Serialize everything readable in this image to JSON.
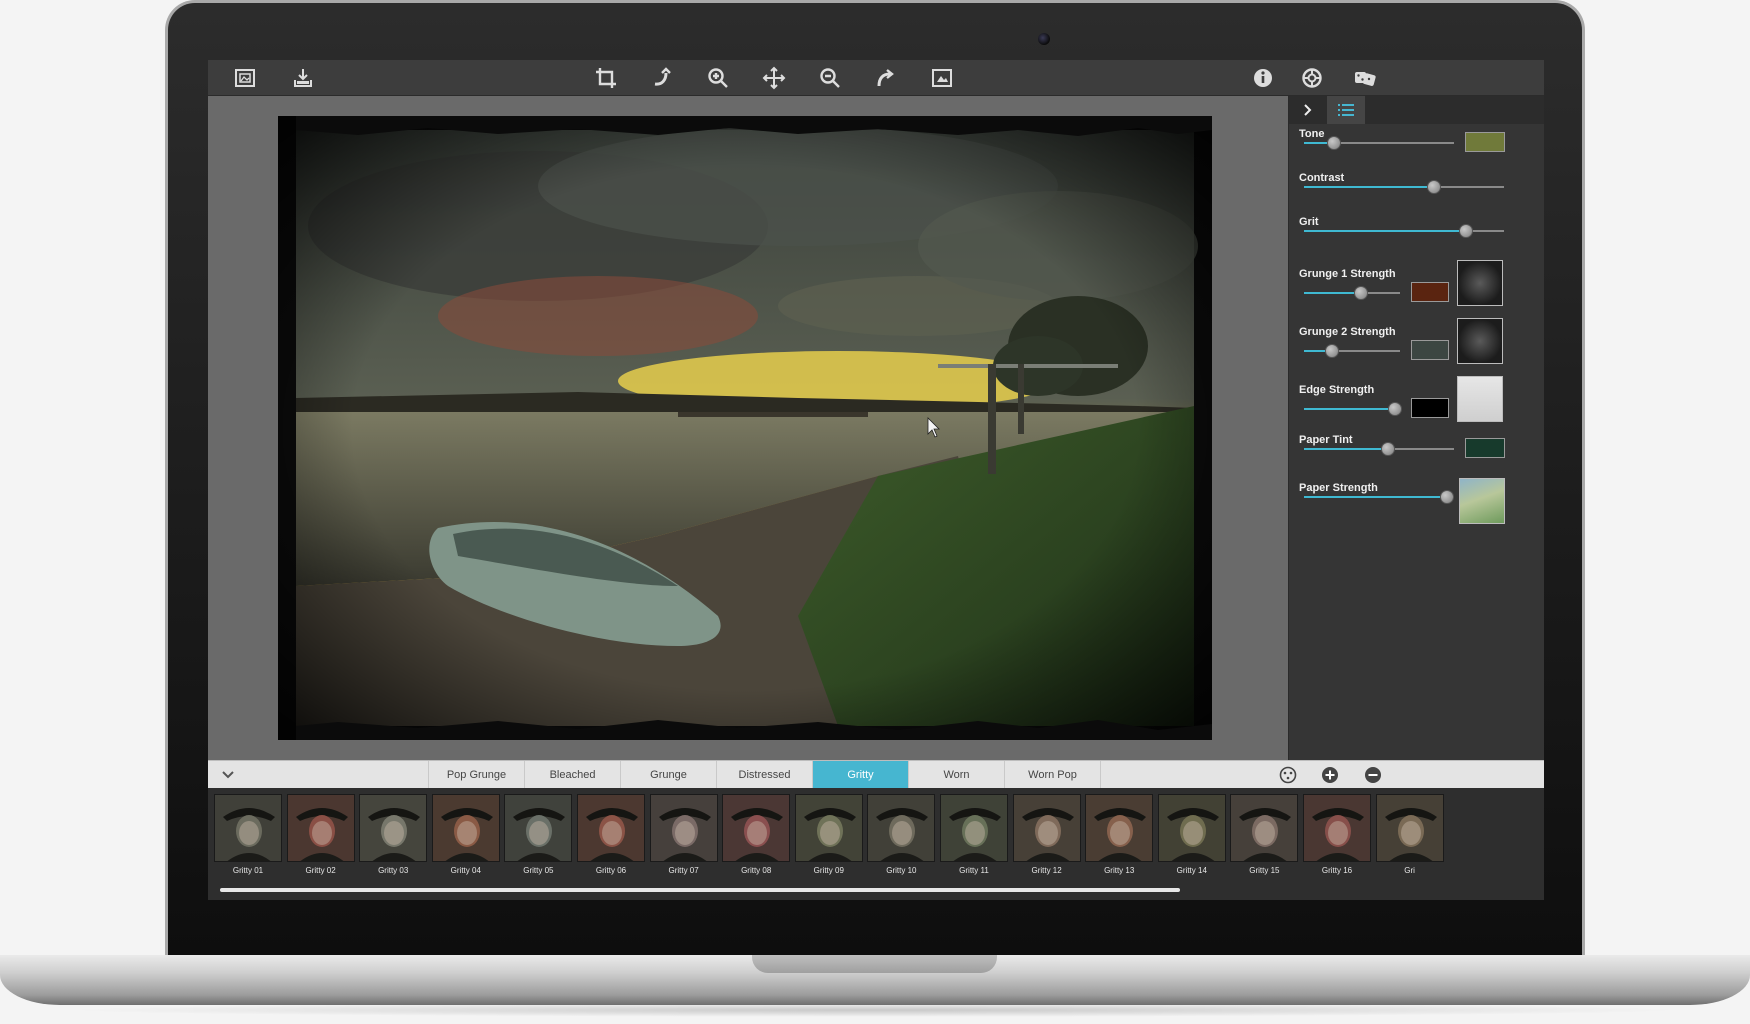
{
  "toolbar": {
    "left": [
      {
        "name": "open-image-icon"
      },
      {
        "name": "save-image-icon"
      }
    ],
    "center": [
      {
        "name": "crop-icon"
      },
      {
        "name": "rotate-icon"
      },
      {
        "name": "zoom-in-icon"
      },
      {
        "name": "pan-icon"
      },
      {
        "name": "zoom-out-icon"
      },
      {
        "name": "share-icon"
      },
      {
        "name": "compare-icon"
      }
    ],
    "right": [
      {
        "name": "info-icon"
      },
      {
        "name": "settings-icon"
      },
      {
        "name": "randomize-icon"
      }
    ]
  },
  "panel": {
    "tabs": [
      {
        "name": "collapse-panel-icon"
      },
      {
        "name": "adjustments-list-icon"
      }
    ],
    "controls": [
      {
        "label": "Tone",
        "value": 0.2,
        "swatch": "#707a3a"
      },
      {
        "label": "Contrast",
        "value": 0.65
      },
      {
        "label": "Grit",
        "value": 0.81
      },
      {
        "label": "Grunge 1 Strength",
        "value": 0.59,
        "swatch": "#5a2410",
        "texture": "dark-grunge"
      },
      {
        "label": "Grunge 2 Strength",
        "value": 0.29,
        "swatch": "#3c4642",
        "texture": "dark-grunge"
      },
      {
        "label": "Edge Strength",
        "value": 0.95,
        "swatch": "#000000",
        "texture": "light-edge"
      },
      {
        "label": "Paper Tint",
        "value": 0.56,
        "swatch": "#173a2c"
      },
      {
        "label": "Paper Strength",
        "value": 0.95,
        "texture": "paper"
      }
    ]
  },
  "presets": {
    "tabs": [
      "Pop Grunge",
      "Bleached",
      "Grunge",
      "Distressed",
      "Gritty",
      "Worn",
      "Worn Pop"
    ],
    "active": "Gritty",
    "right_icons": [
      "random-preset-icon",
      "add-preset-icon",
      "remove-preset-icon"
    ]
  },
  "thumbnails": [
    {
      "label": "Gritty 01",
      "tint": "#6b6b5e"
    },
    {
      "label": "Gritty 02",
      "tint": "#8a4f45"
    },
    {
      "label": "Gritty 03",
      "tint": "#77776b"
    },
    {
      "label": "Gritty 04",
      "tint": "#8a5a45"
    },
    {
      "label": "Gritty 05",
      "tint": "#6a7068"
    },
    {
      "label": "Gritty 06",
      "tint": "#8b5346"
    },
    {
      "label": "Gritty 07",
      "tint": "#7a6a66"
    },
    {
      "label": "Gritty 08",
      "tint": "#8a4f4f"
    },
    {
      "label": "Gritty 09",
      "tint": "#6f7258"
    },
    {
      "label": "Gritty 10",
      "tint": "#6e6a5c"
    },
    {
      "label": "Gritty 11",
      "tint": "#677058"
    },
    {
      "label": "Gritty 12",
      "tint": "#7f6a5a"
    },
    {
      "label": "Gritty 13",
      "tint": "#86604c"
    },
    {
      "label": "Gritty 14",
      "tint": "#6f6c4f"
    },
    {
      "label": "Gritty 15",
      "tint": "#7b6a62"
    },
    {
      "label": "Gritty 16",
      "tint": "#874f4a"
    },
    {
      "label": "Gri",
      "tint": "#7a6a55"
    }
  ],
  "colors": {
    "accent": "#46b6d0",
    "slider_fill": "#3fb9d2"
  }
}
